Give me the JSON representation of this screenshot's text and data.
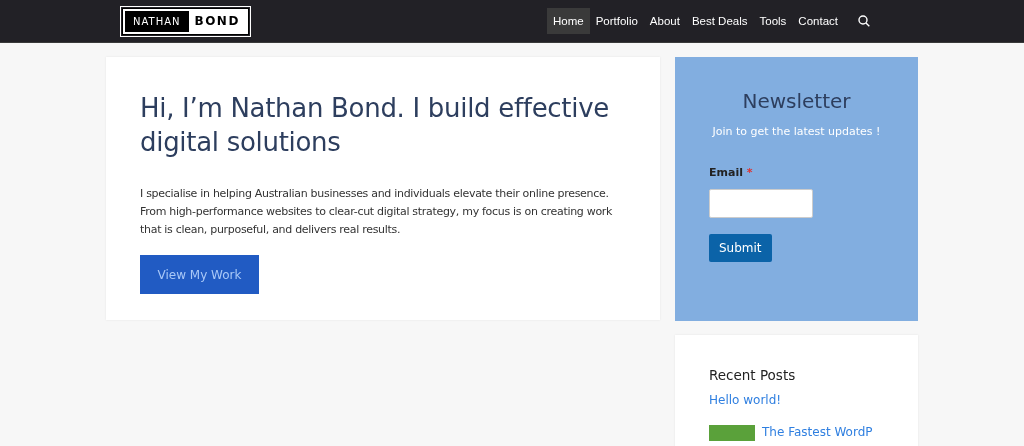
{
  "logo": {
    "left": "NATHAN",
    "right": "BOND"
  },
  "nav": [
    {
      "label": "Home",
      "selected": true
    },
    {
      "label": "Portfolio",
      "selected": false
    },
    {
      "label": "About",
      "selected": false
    },
    {
      "label": "Best Deals",
      "selected": false
    },
    {
      "label": "Tools",
      "selected": false
    },
    {
      "label": "Contact",
      "selected": false
    }
  ],
  "hero": {
    "title": "Hi, I’m Nathan Bond. I build effective digital solutions",
    "text": "I specialise in helping Australian businesses and individuals elevate their online presence. From high-performance websites to clear-cut digital strategy, my focus is on creating work that is clean, purposeful, and delivers real results.",
    "button": "View My Work"
  },
  "newsletter": {
    "title": "Newsletter",
    "subtitle": "Join to get the latest updates !",
    "email_label": "Email",
    "required_mark": "*",
    "submit": "Submit"
  },
  "recent_posts": {
    "title": "Recent Posts",
    "posts": [
      {
        "title": "Hello world!",
        "thumbnail": false
      },
      {
        "title": "The Fastest WordP",
        "thumbnail": true
      }
    ]
  }
}
